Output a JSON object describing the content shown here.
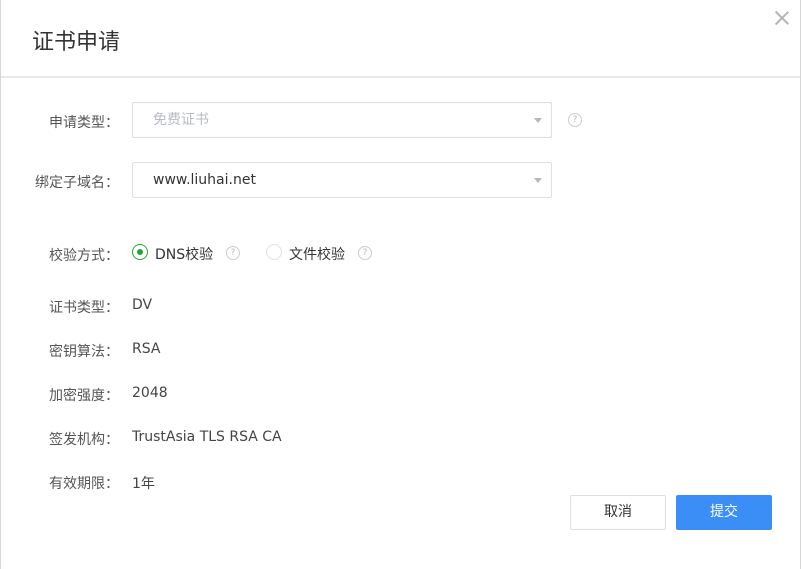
{
  "dialog": {
    "title": "证书申请"
  },
  "form": {
    "apply_type": {
      "label": "申请类型：",
      "placeholder": "免费证书"
    },
    "subdomain": {
      "label": "绑定子域名：",
      "value": "www.liuhai.net"
    },
    "verify_method": {
      "label": "校验方式：",
      "options": [
        {
          "label": "DNS校验",
          "checked": true
        },
        {
          "label": "文件校验",
          "checked": false
        }
      ]
    },
    "cert_type": {
      "label": "证书类型：",
      "value": "DV"
    },
    "key_algorithm": {
      "label": "密钥算法：",
      "value": "RSA"
    },
    "key_strength": {
      "label": "加密强度：",
      "value": "2048"
    },
    "issuer": {
      "label": "签发机构：",
      "value": "TrustAsia TLS RSA CA"
    },
    "validity": {
      "label": "有效期限：",
      "value": "1年"
    }
  },
  "buttons": {
    "cancel": "取消",
    "submit": "提交"
  },
  "help_glyph": "?",
  "colors": {
    "primary": "#3a8ef6",
    "radio_checked": "#20a53a"
  }
}
